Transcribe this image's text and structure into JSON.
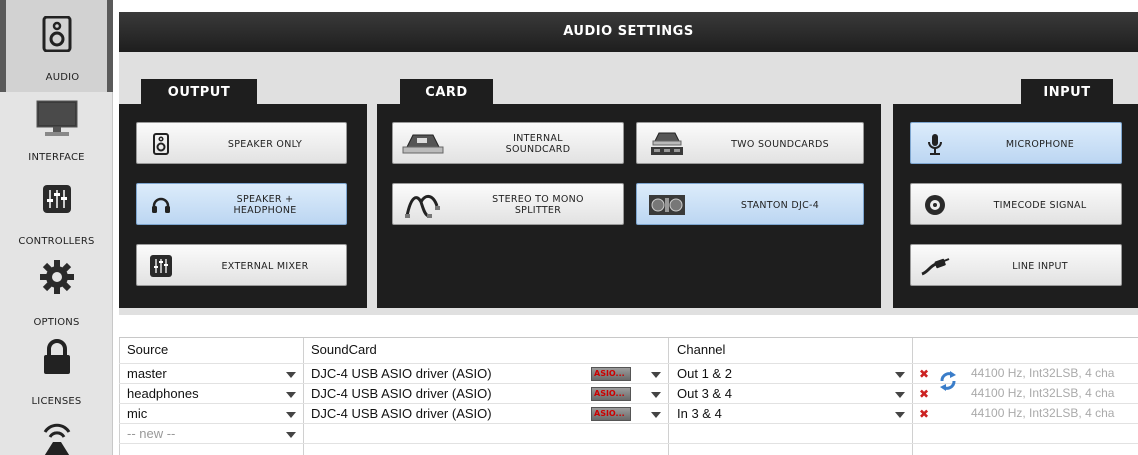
{
  "sidebar": {
    "items": [
      {
        "label": "AUDIO",
        "icon": "speaker-icon",
        "active": true
      },
      {
        "label": "INTERFACE",
        "icon": "monitor-icon"
      },
      {
        "label": "CONTROLLERS",
        "icon": "mixer-icon"
      },
      {
        "label": "OPTIONS",
        "icon": "gear-icon"
      },
      {
        "label": "LICENSES",
        "icon": "lock-icon"
      },
      {
        "label": "",
        "icon": "turntable-icon"
      }
    ]
  },
  "title": "AUDIO SETTINGS",
  "sections": {
    "output": "OUTPUT",
    "card": "CARD",
    "input": "INPUT"
  },
  "output_buttons": [
    {
      "label": "SPEAKER ONLY",
      "icon": "speaker-icon",
      "selected": false
    },
    {
      "label": "SPEAKER +\nHEADPHONE",
      "icon": "headphone-icon",
      "selected": true
    },
    {
      "label": "EXTERNAL MIXER",
      "icon": "mixer-icon",
      "selected": false
    }
  ],
  "card_buttons": [
    {
      "label": "INTERNAL\nSOUNDCARD",
      "icon": "soundcard-icon",
      "selected": false
    },
    {
      "label": "TWO SOUNDCARDS",
      "icon": "two-soundcards-icon",
      "selected": false
    },
    {
      "label": "STEREO TO MONO\nSPLITTER",
      "icon": "splitter-cable-icon",
      "selected": false
    },
    {
      "label": "STANTON DJC-4",
      "icon": "controller-icon",
      "selected": true
    }
  ],
  "input_buttons": [
    {
      "label": "MICROPHONE",
      "icon": "microphone-icon",
      "selected": true
    },
    {
      "label": "TIMECODE SIGNAL",
      "icon": "vinyl-icon",
      "selected": false
    },
    {
      "label": "LINE INPUT",
      "icon": "cable-icon",
      "selected": false
    }
  ],
  "table": {
    "headers": {
      "source": "Source",
      "soundcard": "SoundCard",
      "channel": "Channel"
    },
    "rows": [
      {
        "source": "master",
        "soundcard": "DJC-4 USB ASIO driver (ASIO)",
        "asio": "ASIO...",
        "channel": "Out 1 & 2",
        "info": "44100 Hz, Int32LSB, 4 cha"
      },
      {
        "source": "headphones",
        "soundcard": "DJC-4 USB ASIO driver (ASIO)",
        "asio": "ASIO...",
        "channel": "Out 3 & 4",
        "info": "44100 Hz, Int32LSB, 4 cha"
      },
      {
        "source": "mic",
        "soundcard": "DJC-4 USB ASIO driver (ASIO)",
        "asio": "ASIO...",
        "channel": "In 3 & 4",
        "info": "44100 Hz, Int32LSB, 4 cha"
      }
    ],
    "new_row_placeholder": "-- new --"
  },
  "colors": {
    "selected_button": "#bcd6f2",
    "panel_dark": "#1e1e1e",
    "remove_icon": "#cc2222",
    "refresh_icon": "#3a7dc9"
  }
}
